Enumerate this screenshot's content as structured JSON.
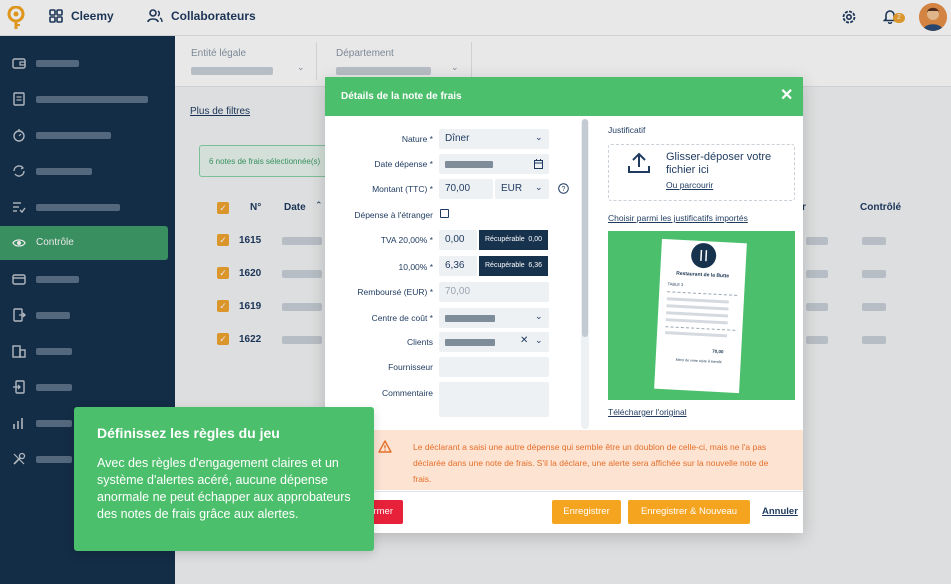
{
  "topbar": {
    "app_name": "Cleemy",
    "collaborators": "Collaborateurs",
    "notification_count": "2"
  },
  "sidebar": {
    "active_label": "Contrôle",
    "items": [
      {
        "icon": "wallet-icon"
      },
      {
        "icon": "document-icon"
      },
      {
        "icon": "clock-icon"
      },
      {
        "icon": "refresh-icon"
      },
      {
        "icon": "checklist-icon"
      },
      {
        "icon": "eye-icon",
        "label": "Contrôle"
      },
      {
        "icon": "card-icon"
      },
      {
        "icon": "export-icon"
      },
      {
        "icon": "building-icon"
      },
      {
        "icon": "import-icon"
      },
      {
        "icon": "chart-icon"
      },
      {
        "icon": "tools-icon"
      }
    ]
  },
  "filters": {
    "entity": "Entité légale",
    "department": "Département",
    "more": "Plus de filtres"
  },
  "selection": "6 notes de frais sélectionnée(s)",
  "table": {
    "headers": {
      "number": "N°",
      "date": "Date",
      "controlled": "Contrôlé"
    },
    "rows": [
      "1615",
      "1620",
      "1619",
      "1622"
    ]
  },
  "modal": {
    "title": "Détails de la note de frais",
    "close": "✕",
    "form": {
      "nature_label": "Nature *",
      "nature_value": "Dîner",
      "date_label": "Date dépense *",
      "amount_label": "Montant (TTC) *",
      "amount_value": "70,00",
      "currency": "EUR",
      "foreign_label": "Dépense à l'étranger",
      "vat20_label": "TVA 20,00% *",
      "vat20_value": "0,00",
      "vat10_label": "10,00% *",
      "vat10_value": "6,36",
      "recoverable": "Récupérable",
      "rec20_value": "0,00",
      "rec10_value": "6,36",
      "reimbursed_label": "Remboursé (EUR) *",
      "reimbursed_value": "70,00",
      "costcenter_label": "Centre de coût *",
      "clients_label": "Clients",
      "supplier_label": "Fournisseur",
      "comment_label": "Commentaire"
    },
    "attachment": {
      "label": "Justificatif",
      "drop_title": "Glisser-déposer votre fichier ici",
      "browse": "Ou parcourir",
      "choose": "Choisir parmi les justificatifs importés",
      "download": "Télécharger l'original",
      "receipt_restaurant": "Restaurant de la Butte",
      "receipt_table": "TABLE 3",
      "receipt_total": "70,00",
      "receipt_thanks": "Merci de votre visite À bientôt"
    },
    "alert": "Le déclarant a saisi une autre dépense qui semble être un doublon de celle-ci, mais ne l'a pas déclarée dans une note de frais. S'il la déclare, une alerte sera affichée sur la nouvelle note de frais.",
    "buttons": {
      "confirm_partial": "rmer",
      "save": "Enregistrer",
      "save_new": "Enregistrer & Nouveau",
      "cancel": "Annuler"
    }
  },
  "callout": {
    "title": "Définissez les règles du jeu",
    "body": "Avec des règles d'engagement claires et un système d'alertes acéré, aucune dépense anormale ne peut échapper aux approbateurs des notes de frais grâce aux alertes."
  },
  "colors": {
    "green": "#4cbf6c",
    "navy": "#17324d",
    "orange": "#f5a41f",
    "red": "#e8213a",
    "alert_bg": "#fde3d2",
    "alert_text": "#e36f2b"
  }
}
